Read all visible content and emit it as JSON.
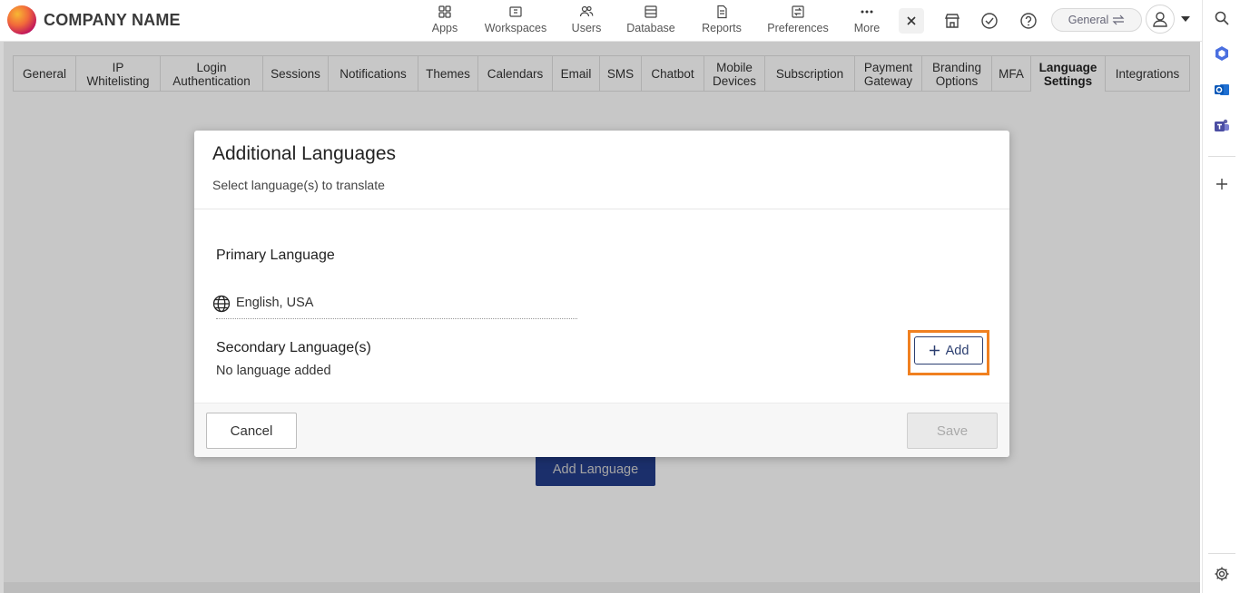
{
  "header": {
    "company": "COMPANY NAME",
    "nav": [
      {
        "label": "Apps",
        "icon": "apps-grid-icon"
      },
      {
        "label": "Workspaces",
        "icon": "workspaces-icon"
      },
      {
        "label": "Users",
        "icon": "users-icon"
      },
      {
        "label": "Database",
        "icon": "database-icon"
      },
      {
        "label": "Reports",
        "icon": "reports-icon"
      },
      {
        "label": "Preferences",
        "icon": "preferences-icon"
      },
      {
        "label": "More",
        "icon": "more-dots-icon"
      }
    ],
    "workspace_pill": "General"
  },
  "tabs": [
    "General",
    "IP\nWhitelisting",
    "Login\nAuthentication",
    "Sessions",
    "Notifications",
    "Themes",
    "Calendars",
    "Email",
    "SMS",
    "Chatbot",
    "Mobile\nDevices",
    "Subscription",
    "Payment\nGateway",
    "Branding\nOptions",
    "MFA",
    "Language\nSettings",
    "Integrations"
  ],
  "active_tab": "Language\nSettings",
  "background": {
    "add_language_label": "Add Language"
  },
  "modal": {
    "title": "Additional Languages",
    "subtitle": "Select language(s) to translate",
    "primary_label": "Primary Language",
    "primary_value": "English, USA",
    "secondary_label": "Secondary Language(s)",
    "secondary_empty": "No language added",
    "add_label": "Add",
    "cancel_label": "Cancel",
    "save_label": "Save"
  },
  "colors": {
    "highlight": "#f08020",
    "primary_button": "#2b4aa8",
    "accent_text": "#2b3e70"
  }
}
